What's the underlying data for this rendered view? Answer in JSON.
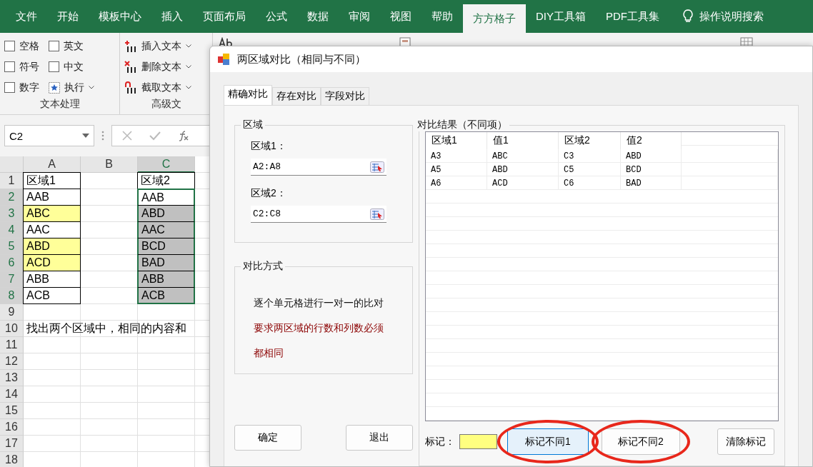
{
  "ribbon_tabs": [
    {
      "label": "文件",
      "selected": false
    },
    {
      "label": "开始",
      "selected": false
    },
    {
      "label": "模板中心",
      "selected": false
    },
    {
      "label": "插入",
      "selected": false
    },
    {
      "label": "页面布局",
      "selected": false
    },
    {
      "label": "公式",
      "selected": false
    },
    {
      "label": "数据",
      "selected": false
    },
    {
      "label": "审阅",
      "selected": false
    },
    {
      "label": "视图",
      "selected": false
    },
    {
      "label": "帮助",
      "selected": false
    },
    {
      "label": "方方格子",
      "selected": true
    },
    {
      "label": "DIY工具箱",
      "selected": false
    },
    {
      "label": "PDF工具集",
      "selected": false
    }
  ],
  "tell_me": {
    "label": "操作说明搜索"
  },
  "ribbon": {
    "text_group": {
      "checkboxes": [
        {
          "label": "空格",
          "checked": false
        },
        {
          "label": "英文",
          "checked": false
        },
        {
          "label": "符号",
          "checked": false
        },
        {
          "label": "中文",
          "checked": false
        },
        {
          "label": "数字",
          "checked": false
        }
      ],
      "run": "执行",
      "title": "文本处理"
    },
    "advanced_group": {
      "commands": [
        {
          "kind": "insert",
          "label": "插入文本"
        },
        {
          "kind": "delete",
          "label": "删除文本"
        },
        {
          "kind": "extract",
          "label": "截取文本"
        }
      ],
      "title": "高级文"
    }
  },
  "formula_bar": {
    "name_box": "C2"
  },
  "sheet": {
    "columns": [
      {
        "label": "A",
        "selected": false
      },
      {
        "label": "B",
        "selected": false
      },
      {
        "label": "C",
        "selected": true
      }
    ],
    "rows": [
      {
        "number": "1",
        "selected": false,
        "column_a": {
          "value": "区域1",
          "bordered": true
        },
        "column_c": {
          "value": "区域2",
          "bordered": true,
          "selected": false
        }
      },
      {
        "number": "2",
        "selected": true,
        "column_a": {
          "value": "AAB",
          "bordered": true
        },
        "column_c": {
          "value": "AAB",
          "bordered": true,
          "selected": true
        }
      },
      {
        "number": "3",
        "selected": true,
        "column_a": {
          "value": "ABC",
          "bordered": true,
          "color": "#ffff99"
        },
        "column_c": {
          "value": "ABD",
          "bordered": true,
          "selected": true,
          "color": "#c0c0c0"
        }
      },
      {
        "number": "4",
        "selected": true,
        "column_a": {
          "value": "AAC",
          "bordered": true
        },
        "column_c": {
          "value": "AAC",
          "bordered": true,
          "selected": true,
          "color": "#c0c0c0"
        }
      },
      {
        "number": "5",
        "selected": true,
        "column_a": {
          "value": "ABD",
          "bordered": true,
          "color": "#ffff99"
        },
        "column_c": {
          "value": "BCD",
          "bordered": true,
          "selected": true,
          "color": "#c0c0c0"
        }
      },
      {
        "number": "6",
        "selected": true,
        "column_a": {
          "value": "ACD",
          "bordered": true,
          "color": "#ffff99"
        },
        "column_c": {
          "value": "BAD",
          "bordered": true,
          "selected": true,
          "color": "#c0c0c0"
        }
      },
      {
        "number": "7",
        "selected": true,
        "column_a": {
          "value": "ABB",
          "bordered": true
        },
        "column_c": {
          "value": "ABB",
          "bordered": true,
          "selected": true,
          "color": "#c0c0c0"
        }
      },
      {
        "number": "8",
        "selected": true,
        "column_a": {
          "value": "ACB",
          "bordered": true
        },
        "column_c": {
          "value": "ACB",
          "bordered": true,
          "selected": true,
          "color": "#c0c0c0"
        }
      },
      {
        "number": "9",
        "selected": false
      },
      {
        "number": "10",
        "selected": false,
        "note": "找出两个区域中，相同的内容和"
      },
      {
        "number": "11",
        "selected": false
      },
      {
        "number": "12",
        "selected": false
      },
      {
        "number": "13",
        "selected": false
      },
      {
        "number": "14",
        "selected": false
      },
      {
        "number": "15",
        "selected": false
      },
      {
        "number": "16",
        "selected": false
      },
      {
        "number": "17",
        "selected": false
      },
      {
        "number": "18",
        "selected": false
      }
    ]
  },
  "dialog": {
    "title": "两区域对比（相同与不同）",
    "tabs": [
      {
        "label": "精确对比",
        "selected": true
      },
      {
        "label": "存在对比",
        "selected": false
      },
      {
        "label": "字段对比",
        "selected": false
      }
    ],
    "range_group": {
      "title": "区域",
      "fields": [
        {
          "label": "区域1：",
          "value": "A2:A8"
        },
        {
          "label": "区域2：",
          "value": "C2:C8"
        }
      ]
    },
    "mode_group": {
      "title": "对比方式",
      "lines": [
        {
          "kind": "normal",
          "text": "逐个单元格进行一对一的比对"
        },
        {
          "kind": "warning",
          "text": "要求两区域的行数和列数必须"
        },
        {
          "kind": "warning",
          "text": "都相同"
        }
      ]
    },
    "buttons": [
      "确定",
      "退出"
    ],
    "result_group": {
      "title": "对比结果（不同项）",
      "columns": [
        "区域1",
        "值1",
        "区域2",
        "值2"
      ],
      "rows": [
        [
          "A3",
          "ABC",
          "C3",
          "ABD"
        ],
        [
          "A5",
          "ABD",
          "C5",
          "BCD"
        ],
        [
          "A6",
          "ACD",
          "C6",
          "BAD"
        ]
      ]
    },
    "mark": {
      "label": "标记：",
      "color": "#ffff80"
    },
    "mark_buttons": [
      {
        "label": "标记不同1",
        "selected": true,
        "circled": true
      },
      {
        "label": "标记不同2",
        "selected": false,
        "circled": true
      },
      {
        "label": "清除标记",
        "selected": false,
        "circled": false
      }
    ]
  }
}
